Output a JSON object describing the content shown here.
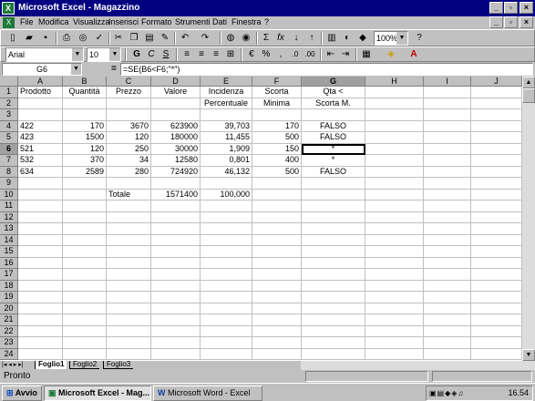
{
  "window": {
    "title": "Microsoft Excel - Magazzino"
  },
  "menu": [
    "File",
    "Modifica",
    "Visualizza",
    "Inserisci",
    "Formato",
    "Strumenti",
    "Dati",
    "Finestra",
    "?"
  ],
  "toolbar": {
    "zoom": "100%",
    "font_name": "Arial",
    "font_size": "10",
    "bold": "G",
    "italic": "C",
    "underline": "S",
    "sum": "Σ",
    "fx": "fx",
    "percent": "%"
  },
  "formula": {
    "namebox": "G6",
    "eq": "=",
    "content": "=SE(B6<F6;\"*\")"
  },
  "columns": [
    "A",
    "B",
    "C",
    "D",
    "E",
    "F",
    "G",
    "H",
    "I",
    "J"
  ],
  "rows": [
    "1",
    "2",
    "3",
    "4",
    "5",
    "6",
    "7",
    "8",
    "9",
    "10",
    "11",
    "12",
    "13",
    "14",
    "15",
    "16",
    "17",
    "18",
    "19",
    "20",
    "21",
    "22",
    "23",
    "24"
  ],
  "cells": {
    "A1": "Prodotto",
    "B1": "Quantità",
    "C1": "Prezzo",
    "D1": "Valore",
    "E1": "Incidenza",
    "F1": "Scorta",
    "G1": "Qta <",
    "E2": "Percentuale",
    "F2": "Minima",
    "G2": "Scorta M.",
    "A4": "422",
    "B4": "170",
    "C4": "3670",
    "D4": "623900",
    "E4": "39,703",
    "F4": "170",
    "G4": "FALSO",
    "A5": "423",
    "B5": "1500",
    "C5": "120",
    "D5": "180000",
    "E5": "11,455",
    "F5": "500",
    "G5": "FALSO",
    "A6": "521",
    "B6": "120",
    "C6": "250",
    "D6": "30000",
    "E6": "1,909",
    "F6": "150",
    "G6": "*",
    "A7": "532",
    "B7": "370",
    "C7": "34",
    "D7": "12580",
    "E7": "0,801",
    "F7": "400",
    "G7": "*",
    "A8": "634",
    "B8": "2589",
    "C8": "280",
    "D8": "724920",
    "E8": "46,132",
    "F8": "500",
    "G8": "FALSO",
    "C10": "Totale",
    "D10": "1571400",
    "E10": "100,000"
  },
  "sheets": [
    "Foglio1",
    "Foglio2",
    "Foglio3"
  ],
  "status": "Pronto",
  "taskbar": {
    "start": "Avvio",
    "task1": "Microsoft Excel - Mag...",
    "task2": "Microsoft Word - Excel",
    "clock": "16.54"
  }
}
